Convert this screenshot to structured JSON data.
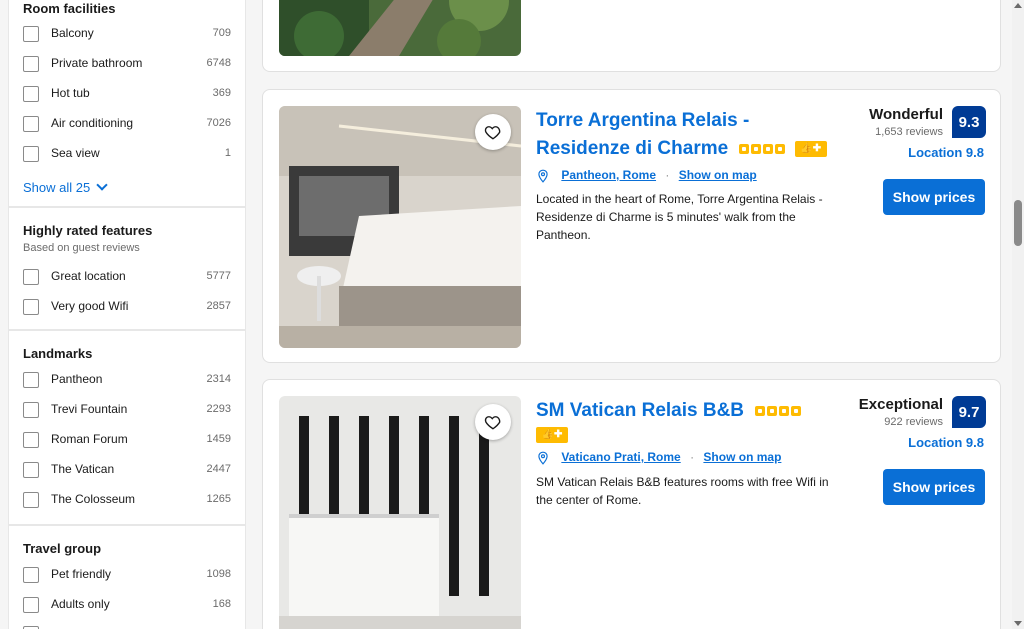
{
  "sidebar": {
    "room_facilities": {
      "title": "Room facilities",
      "items": [
        {
          "label": "Balcony",
          "count": "709"
        },
        {
          "label": "Private bathroom",
          "count": "6748"
        },
        {
          "label": "Hot tub",
          "count": "369"
        },
        {
          "label": "Air conditioning",
          "count": "7026"
        },
        {
          "label": "Sea view",
          "count": "1"
        }
      ],
      "show_all": "Show all 25"
    },
    "highly_rated": {
      "title": "Highly rated features",
      "subtitle": "Based on guest reviews",
      "items": [
        {
          "label": "Great location",
          "count": "5777"
        },
        {
          "label": "Very good Wifi",
          "count": "2857"
        }
      ]
    },
    "landmarks": {
      "title": "Landmarks",
      "items": [
        {
          "label": "Pantheon",
          "count": "2314"
        },
        {
          "label": "Trevi Fountain",
          "count": "2293"
        },
        {
          "label": "Roman Forum",
          "count": "1459"
        },
        {
          "label": "The Vatican",
          "count": "2447"
        },
        {
          "label": "The Colosseum",
          "count": "1265"
        }
      ]
    },
    "travel_group": {
      "title": "Travel group",
      "items": [
        {
          "label": "Pet friendly",
          "count": "1098"
        },
        {
          "label": "Adults only",
          "count": "168"
        }
      ]
    }
  },
  "hotels": [
    {
      "name_line1": "Torre Argentina Relais -",
      "name_line2": "Residenze di Charme",
      "location": "Pantheon, Rome",
      "show_on_map": "Show on map",
      "description": "Located in the heart of Rome, Torre Argentina Relais - Residenze di Charme is 5 minutes' walk from the Pantheon.",
      "rating_word": "Wonderful",
      "reviews": "1,653 reviews",
      "score": "9.3",
      "location_score": "Location 9.8",
      "button": "Show prices"
    },
    {
      "name_line1": "SM Vatican Relais B&B",
      "location": "Vaticano Prati, Rome",
      "show_on_map": "Show on map",
      "description": "SM Vatican Relais B&B features rooms with free Wifi in the center of Rome.",
      "rating_word": "Exceptional",
      "reviews": "922 reviews",
      "score": "9.7",
      "location_score": "Location 9.8",
      "button": "Show prices"
    }
  ],
  "colors": {
    "brand_blue": "#0a6fd6",
    "score_blue": "#003b95",
    "star_yellow": "#febb02"
  }
}
